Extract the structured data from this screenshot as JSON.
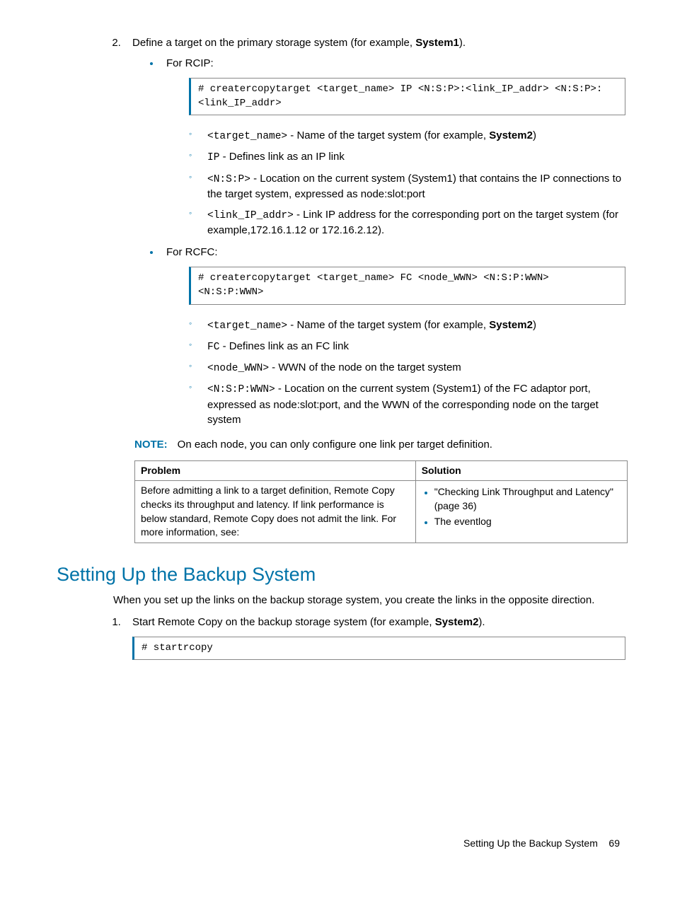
{
  "step2": {
    "text_a": "Define a target on the primary storage system (for example, ",
    "text_bold": "System1",
    "text_b": ")."
  },
  "rcip": {
    "label": "For RCIP:",
    "code": "# creatercopytarget <target_name> IP <N:S:P>:<link_IP_addr> <N:S:P>:<link_IP_addr>",
    "items": {
      "target_code": "<target_name>",
      "target_desc_a": " - Name of the target system (for example, ",
      "target_desc_bold": "System2",
      "target_desc_b": ")",
      "ip_code": "IP",
      "ip_desc": " - Defines link as an IP link",
      "nsp_code": "<N:S:P>",
      "nsp_desc": " - Location on the current system (System1) that contains the IP connections to the target system, expressed as node:slot:port",
      "link_code": "<link_IP_addr>",
      "link_desc": " - Link IP address for the corresponding port on the target system (for example,172.16.1.12 or 172.16.2.12)."
    }
  },
  "rcfc": {
    "label": "For RCFC:",
    "code": "# creatercopytarget <target_name> FC <node_WWN> <N:S:P:WWN> <N:S:P:WWN>",
    "items": {
      "target_code": "<target_name>",
      "target_desc_a": " - Name of the target system (for example, ",
      "target_desc_bold": "System2",
      "target_desc_b": ")",
      "fc_code": "FC",
      "fc_desc": " - Defines link as an FC link",
      "wwn_code": "<node_WWN>",
      "wwn_desc": " - WWN of the node on the target system",
      "nsp_code": "<N:S:P:WWN>",
      "nsp_desc": " - Location on the current system (System1) of the FC adaptor port, expressed as node:slot:port, and the WWN of the corresponding node on the target system"
    }
  },
  "note": {
    "label": "NOTE:",
    "text": "On each node, you can only configure one link per target definition."
  },
  "table": {
    "h1": "Problem",
    "h2": "Solution",
    "problem": "Before admitting a link to a target definition, Remote Copy checks its throughput and latency. If link performance is below standard, Remote Copy does not admit the link. For more information, see:",
    "sol1": "\"Checking Link Throughput and Latency\" (page 36)",
    "sol2": "The eventlog"
  },
  "section2": {
    "heading": "Setting Up the Backup System",
    "para": "When you set up the links on the backup storage system, you create the links in the opposite direction.",
    "step1_a": "Start Remote Copy on the backup storage system (for example, ",
    "step1_bold": "System2",
    "step1_b": ").",
    "code": "# startrcopy"
  },
  "footer": {
    "title": "Setting Up the Backup System",
    "page": "69"
  }
}
